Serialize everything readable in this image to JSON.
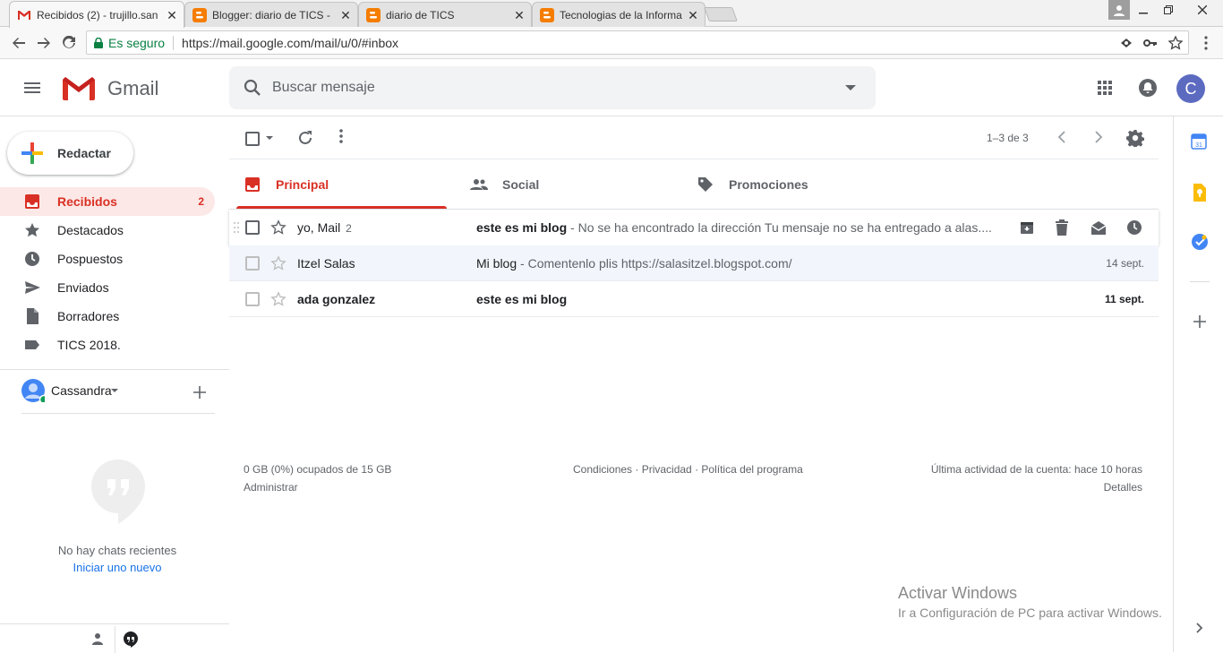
{
  "browser": {
    "tabs": [
      {
        "title": "Recibidos (2) - trujillo.san",
        "favicon": "gmail-icon",
        "active": true
      },
      {
        "title": "Blogger: diario de TICS -",
        "favicon": "blogger-icon",
        "active": false
      },
      {
        "title": "diario de TICS",
        "favicon": "blogger-icon",
        "active": false
      },
      {
        "title": "Tecnologias de la Informa",
        "favicon": "blogger-icon",
        "active": false
      }
    ],
    "close_glyph": "✕",
    "secure_label": "Es seguro",
    "url": "https://mail.google.com/mail/u/0/#inbox"
  },
  "header": {
    "app_name": "Gmail",
    "search_placeholder": "Buscar mensaje",
    "avatar_letter": "C"
  },
  "sidebar": {
    "compose_label": "Redactar",
    "items": [
      {
        "label": "Recibidos",
        "count": "2",
        "icon": "inbox-icon",
        "active": true
      },
      {
        "label": "Destacados",
        "count": "",
        "icon": "star-icon",
        "active": false
      },
      {
        "label": "Pospuestos",
        "count": "",
        "icon": "clock-icon",
        "active": false
      },
      {
        "label": "Enviados",
        "count": "",
        "icon": "send-icon",
        "active": false
      },
      {
        "label": "Borradores",
        "count": "",
        "icon": "draft-icon",
        "active": false
      },
      {
        "label": "TICS 2018.",
        "count": "",
        "icon": "label-icon",
        "active": false
      }
    ]
  },
  "toolbar": {
    "pagination": "1–3 de 3"
  },
  "categories": [
    {
      "label": "Principal",
      "icon": "inbox-icon",
      "active": true
    },
    {
      "label": "Social",
      "icon": "people-icon",
      "active": false
    },
    {
      "label": "Promociones",
      "icon": "tag-icon",
      "active": false
    }
  ],
  "emails": [
    {
      "sender": "yo, Mail",
      "sender_count": "2",
      "subject": "este es mi blog",
      "snippet": " - No se ha encontrado la dirección Tu mensaje no se ha entregado a alas....",
      "date": "",
      "unread": true,
      "hovered": true
    },
    {
      "sender": "Itzel Salas",
      "sender_count": "",
      "subject": "Mi blog",
      "snippet": " - Comentenlo plis https://salasitzel.blogspot.com/",
      "date": "14 sept.",
      "unread": false,
      "hovered": false
    },
    {
      "sender": "ada gonzalez",
      "sender_count": "",
      "subject": "este es mi blog",
      "snippet": "",
      "date": "11 sept.",
      "unread": true,
      "hovered": false
    }
  ],
  "footer": {
    "storage": "0 GB (0%) ocupados de 15 GB",
    "admin": "Administrar",
    "links": "Condiciones · Privacidad · Política del programa",
    "activity": "Última actividad de la cuenta: hace 10 horas",
    "details": "Detalles"
  },
  "hangouts": {
    "user": "Cassandra",
    "empty_text": "No hay chats recientes",
    "start_link": "Iniciar uno nuevo"
  },
  "watermark": {
    "title": "Activar Windows",
    "subtitle": "Ir a Configuración de PC para activar Windows."
  },
  "colors": {
    "accent": "#d93025",
    "avatar_bg": "#5c6bc0",
    "link": "#1a73e8"
  }
}
